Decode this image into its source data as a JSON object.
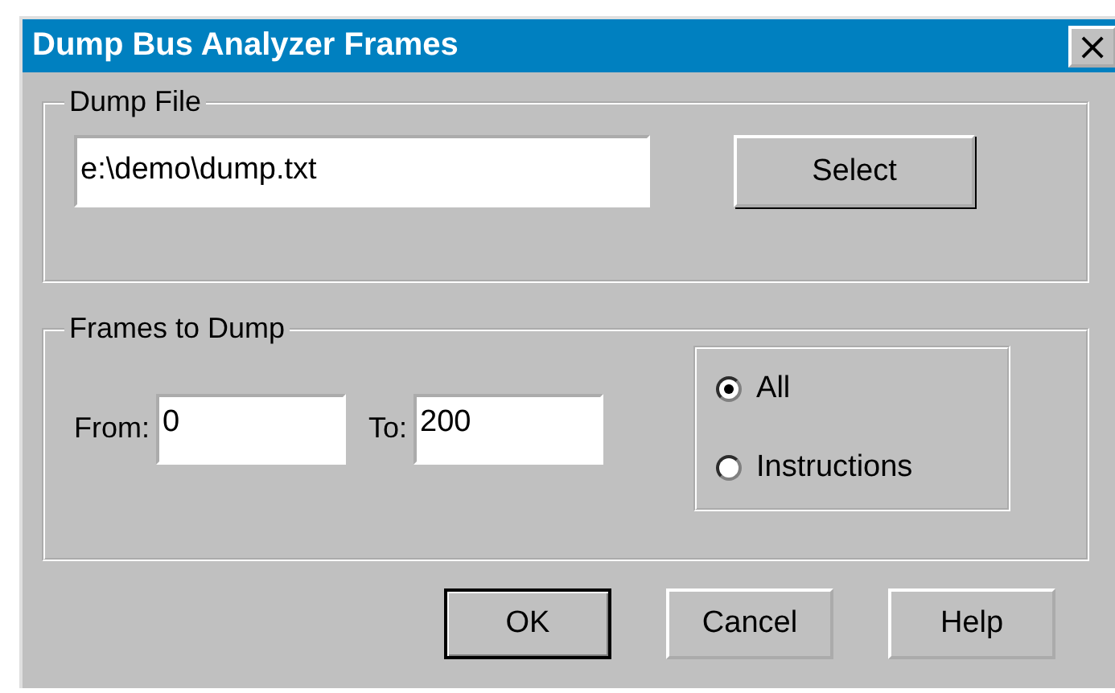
{
  "window": {
    "title": "Dump Bus Analyzer Frames",
    "close_glyph": "×"
  },
  "dump_file": {
    "legend": "Dump File",
    "path": "e:\\demo\\dump.txt",
    "select_button": "Select"
  },
  "frames": {
    "legend": "Frames to Dump",
    "from_label": "From:",
    "from_value": "0",
    "to_label": "To:",
    "to_value": "200",
    "options": [
      {
        "label": "All",
        "selected": true
      },
      {
        "label": "Instructions",
        "selected": false
      }
    ]
  },
  "buttons": [
    {
      "label": "OK",
      "default": true
    },
    {
      "label": "Cancel",
      "default": false
    },
    {
      "label": "Help",
      "default": false
    }
  ]
}
